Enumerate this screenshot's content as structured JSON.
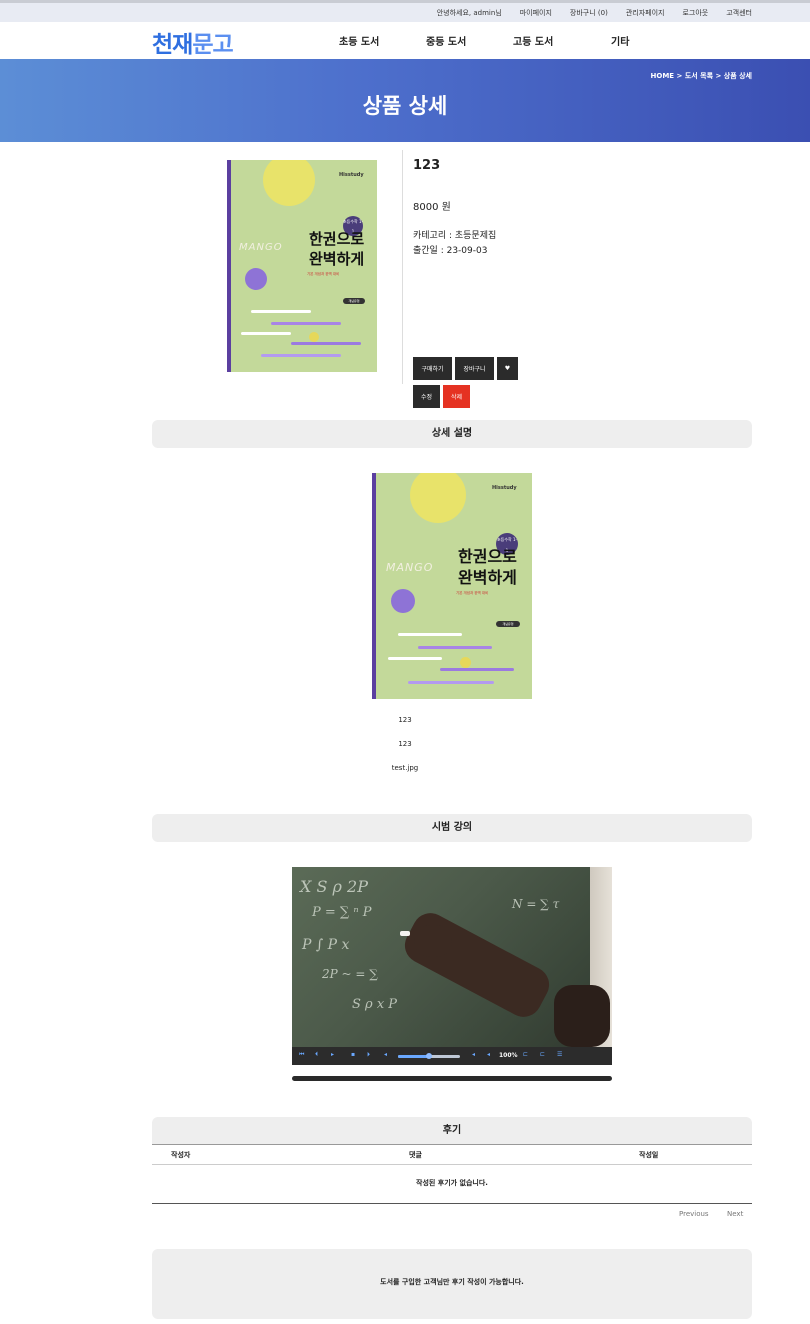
{
  "util_bar": {
    "greeting": "안녕하세요, admin님",
    "links": [
      "마이페이지",
      "장바구니 (0)",
      "관리자페이지",
      "로그아웃",
      "고객센터"
    ]
  },
  "logo": {
    "part1": "천재",
    "part2": "문고"
  },
  "nav": [
    "초등 도서",
    "중등 도서",
    "고등 도서",
    "기타"
  ],
  "hero": {
    "breadcrumb": [
      "HOME",
      "도서 목록",
      "상품 상세"
    ],
    "breadcrumb_sep": " > ",
    "title": "상품 상세"
  },
  "product": {
    "name": "123",
    "price": "8000 원",
    "category": "카테고리 : 초등문제집",
    "release": "출간일 : 23-09-03",
    "buttons": {
      "buy": "구매하기",
      "cart": "장바구니",
      "wish": "♥",
      "edit": "수정",
      "delete": "삭제"
    }
  },
  "cover": {
    "brand": "Hisstudy",
    "badge": "초등수학 1-1",
    "title_line1": "한권으로",
    "title_line2": "완벽하게",
    "subtitle": "기본 개념과 완벽 대비",
    "mango": "MANGO",
    "pill": "개념유형"
  },
  "detail_section": {
    "heading": "상세 설명",
    "texts": [
      "123",
      "123",
      "test.jpg"
    ]
  },
  "lecture_section": {
    "heading": "시범 강의",
    "volume_percent": "100%",
    "volume_level": 0.5
  },
  "review_section": {
    "heading": "후기",
    "columns": [
      "작성자",
      "댓글",
      "작성일"
    ],
    "empty_message": "작성된 후기가 없습니다.",
    "pager": {
      "previous": "Previous",
      "next": "Next"
    },
    "notice": "도서를 구입한 고객님만 후기 작성이 가능합니다."
  }
}
